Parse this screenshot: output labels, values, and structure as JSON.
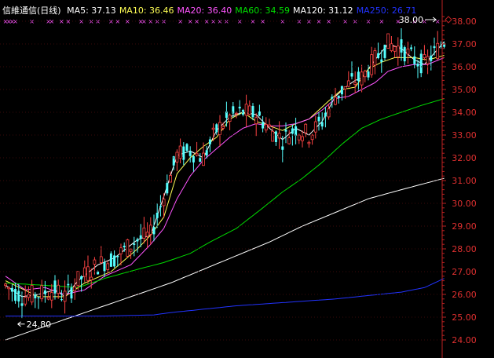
{
  "legend": {
    "title": "信維通信(日线)",
    "items": [
      {
        "label": "MA5: 37.13",
        "color": "#ffffff"
      },
      {
        "label": "MA10: 36.46",
        "color": "#ffff55"
      },
      {
        "label": "MA20: 36.40",
        "color": "#ff55ff"
      },
      {
        "label": "MA60: 34.59",
        "color": "#00dd00"
      },
      {
        "label": "MA120: 31.12",
        "color": "#ffffff"
      },
      {
        "label": "MA250: 26.71",
        "color": "#2233ff"
      }
    ]
  },
  "colors": {
    "up": "#ff4444",
    "down": "#55ffff",
    "axis": "#bb2222",
    "tick_text": "#e03030",
    "markers": "#ff55ff"
  },
  "chart_data": {
    "type": "candlestick",
    "title": "信維通信(日线)",
    "ylim": [
      23.6,
      38.4
    ],
    "yticks": [
      "24.00",
      "25.00",
      "26.00",
      "27.00",
      "28.00",
      "29.00",
      "30.00",
      "31.00",
      "32.00",
      "33.00",
      "34.00",
      "35.00",
      "36.00",
      "37.00",
      "38.00"
    ],
    "annotations": [
      {
        "label": "24.80",
        "type": "low",
        "bar": 3,
        "value": 24.8
      },
      {
        "label": "38.00",
        "type": "high",
        "bar": 131,
        "value": 38.0
      }
    ],
    "series": [
      {
        "name": "MA5",
        "color": "#ffffff",
        "points": [
          [
            0,
            26.4
          ],
          [
            5,
            25.9
          ],
          [
            10,
            26.0
          ],
          [
            15,
            26.2
          ],
          [
            18,
            25.9
          ],
          [
            22,
            26.6
          ],
          [
            28,
            27.3
          ],
          [
            33,
            27.6
          ],
          [
            40,
            28.4
          ],
          [
            44,
            28.6
          ],
          [
            48,
            30.3
          ],
          [
            52,
            32.1
          ],
          [
            56,
            32.3
          ],
          [
            60,
            32.0
          ],
          [
            64,
            33.2
          ],
          [
            68,
            33.8
          ],
          [
            72,
            34.0
          ],
          [
            76,
            33.9
          ],
          [
            80,
            33.3
          ],
          [
            84,
            32.8
          ],
          [
            88,
            33.3
          ],
          [
            92,
            33.0
          ],
          [
            96,
            33.6
          ],
          [
            100,
            34.7
          ],
          [
            104,
            35.2
          ],
          [
            106,
            35.4
          ],
          [
            108,
            35.5
          ],
          [
            112,
            36.3
          ],
          [
            116,
            37.0
          ],
          [
            120,
            36.8
          ],
          [
            124,
            36.3
          ],
          [
            127,
            36.1
          ],
          [
            130,
            36.6
          ],
          [
            133,
            37.1
          ]
        ]
      },
      {
        "name": "MA10",
        "color": "#ffff55",
        "points": [
          [
            0,
            26.6
          ],
          [
            10,
            25.9
          ],
          [
            18,
            25.9
          ],
          [
            24,
            26.5
          ],
          [
            32,
            27.0
          ],
          [
            40,
            28.0
          ],
          [
            44,
            28.6
          ],
          [
            48,
            29.4
          ],
          [
            52,
            31.3
          ],
          [
            56,
            32.0
          ],
          [
            60,
            32.5
          ],
          [
            64,
            32.9
          ],
          [
            68,
            33.7
          ],
          [
            72,
            34.0
          ],
          [
            76,
            33.6
          ],
          [
            80,
            33.4
          ],
          [
            84,
            33.2
          ],
          [
            88,
            33.5
          ],
          [
            92,
            33.7
          ],
          [
            98,
            34.5
          ],
          [
            102,
            35.0
          ],
          [
            106,
            35.1
          ],
          [
            110,
            35.9
          ],
          [
            114,
            36.2
          ],
          [
            118,
            36.4
          ],
          [
            124,
            36.4
          ],
          [
            128,
            36.3
          ],
          [
            133,
            36.5
          ]
        ]
      },
      {
        "name": "MA20",
        "color": "#ff55ff",
        "points": [
          [
            0,
            26.8
          ],
          [
            6,
            26.2
          ],
          [
            12,
            26.3
          ],
          [
            18,
            26.0
          ],
          [
            24,
            26.2
          ],
          [
            30,
            26.8
          ],
          [
            38,
            27.3
          ],
          [
            44,
            28.2
          ],
          [
            48,
            28.9
          ],
          [
            52,
            30.2
          ],
          [
            56,
            31.2
          ],
          [
            60,
            31.9
          ],
          [
            64,
            32.4
          ],
          [
            68,
            32.9
          ],
          [
            72,
            33.3
          ],
          [
            76,
            33.5
          ],
          [
            80,
            33.4
          ],
          [
            84,
            33.4
          ],
          [
            88,
            33.5
          ],
          [
            92,
            33.7
          ],
          [
            96,
            34.1
          ],
          [
            100,
            34.6
          ],
          [
            104,
            34.7
          ],
          [
            108,
            35.0
          ],
          [
            112,
            35.3
          ],
          [
            116,
            35.8
          ],
          [
            120,
            36.0
          ],
          [
            124,
            36.1
          ],
          [
            128,
            36.1
          ],
          [
            133,
            36.4
          ]
        ]
      },
      {
        "name": "MA60",
        "color": "#00dd00",
        "points": [
          [
            0,
            26.5
          ],
          [
            12,
            26.4
          ],
          [
            22,
            26.3
          ],
          [
            30,
            26.7
          ],
          [
            40,
            27.1
          ],
          [
            48,
            27.4
          ],
          [
            56,
            27.8
          ],
          [
            62,
            28.3
          ],
          [
            70,
            28.9
          ],
          [
            78,
            29.8
          ],
          [
            84,
            30.5
          ],
          [
            90,
            31.1
          ],
          [
            96,
            31.8
          ],
          [
            102,
            32.6
          ],
          [
            108,
            33.3
          ],
          [
            114,
            33.7
          ],
          [
            120,
            34.0
          ],
          [
            126,
            34.3
          ],
          [
            133,
            34.6
          ]
        ]
      },
      {
        "name": "MA120",
        "color": "#ffffff",
        "points": [
          [
            0,
            24.0
          ],
          [
            10,
            24.5
          ],
          [
            20,
            25.0
          ],
          [
            30,
            25.5
          ],
          [
            40,
            26.0
          ],
          [
            50,
            26.5
          ],
          [
            60,
            27.1
          ],
          [
            70,
            27.7
          ],
          [
            80,
            28.3
          ],
          [
            90,
            29.0
          ],
          [
            100,
            29.6
          ],
          [
            110,
            30.2
          ],
          [
            120,
            30.6
          ],
          [
            133,
            31.1
          ]
        ]
      },
      {
        "name": "MA250",
        "color": "#2233ff",
        "points": [
          [
            0,
            25.05
          ],
          [
            15,
            25.05
          ],
          [
            30,
            25.05
          ],
          [
            45,
            25.1
          ],
          [
            50,
            25.2
          ],
          [
            60,
            25.35
          ],
          [
            70,
            25.5
          ],
          [
            80,
            25.6
          ],
          [
            90,
            25.7
          ],
          [
            100,
            25.8
          ],
          [
            110,
            25.95
          ],
          [
            120,
            26.1
          ],
          [
            127,
            26.3
          ],
          [
            133,
            26.7
          ]
        ]
      }
    ]
  }
}
